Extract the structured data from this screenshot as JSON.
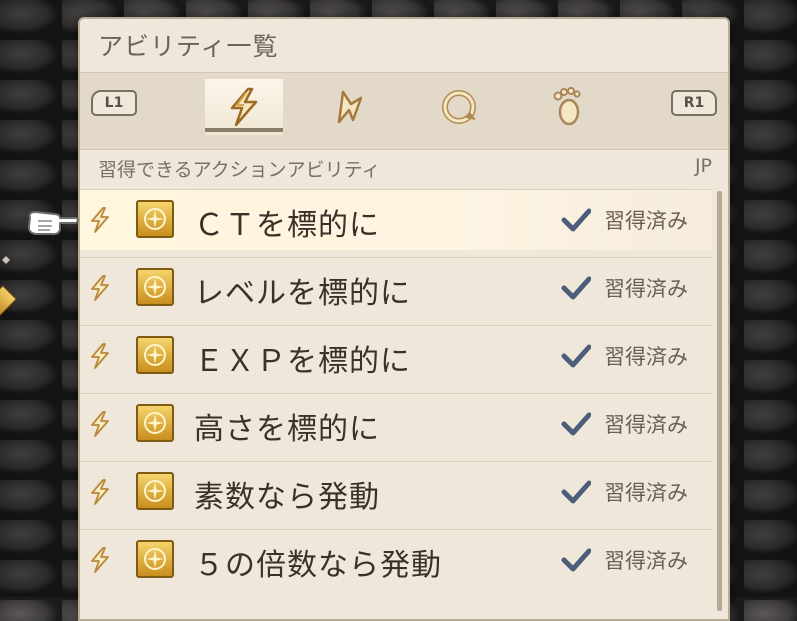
{
  "panel": {
    "title": "アビリティ一覧"
  },
  "tabs": {
    "left_shoulder": "L1",
    "right_shoulder": "R1",
    "items": [
      {
        "icon": "action-bolt-icon",
        "active": true
      },
      {
        "icon": "reaction-icon",
        "active": false
      },
      {
        "icon": "support-icon",
        "active": false
      },
      {
        "icon": "movement-foot-icon",
        "active": false
      }
    ]
  },
  "header": {
    "label": "習得できるアクションアビリティ",
    "jp": "JP"
  },
  "abilities": [
    {
      "name": "ＣＴを標的に",
      "status": "習得済み",
      "selected": true
    },
    {
      "name": "レベルを標的に",
      "status": "習得済み",
      "selected": false
    },
    {
      "name": "ＥＸＰを標的に",
      "status": "習得済み",
      "selected": false
    },
    {
      "name": "高さを標的に",
      "status": "習得済み",
      "selected": false
    },
    {
      "name": "素数なら発動",
      "status": "習得済み",
      "selected": false
    },
    {
      "name": "５の倍数なら発動",
      "status": "習得済み",
      "selected": false
    }
  ],
  "colors": {
    "panel_bg": "#efe7da",
    "badge_gold": "#e2b240",
    "check": "#4e5d7a",
    "accent_bolt": "#c79a3e"
  }
}
